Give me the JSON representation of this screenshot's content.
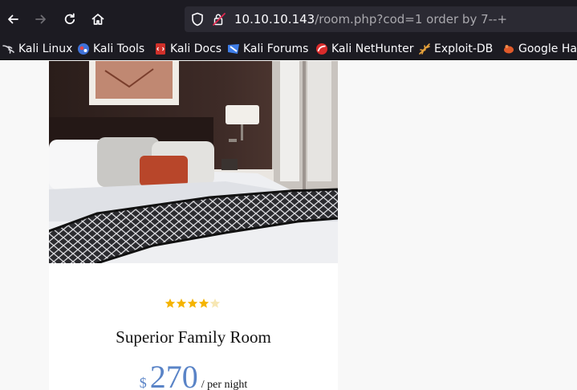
{
  "browser": {
    "url_host": "10.10.10.143",
    "url_path": "/room.php?cod=1 order by 7--+",
    "bookmarks": [
      {
        "label": "Kali Linux",
        "icon": "kali-dragon-icon"
      },
      {
        "label": "Kali Tools",
        "icon": "kali-tools-icon"
      },
      {
        "label": "Kali Docs",
        "icon": "kali-docs-icon"
      },
      {
        "label": "Kali Forums",
        "icon": "kali-forums-icon"
      },
      {
        "label": "Kali NetHunter",
        "icon": "kali-nethunter-icon"
      },
      {
        "label": "Exploit-DB",
        "icon": "exploit-db-icon"
      },
      {
        "label": "Google Hac",
        "icon": "google-hacking-icon"
      }
    ]
  },
  "room": {
    "name": "Superior Family Room",
    "currency": "$",
    "price": "270",
    "price_suffix": "/ per night",
    "rating_stars": 4,
    "rating_max": 5,
    "star_color": "#f5b400",
    "price_color": "#5a84c7"
  }
}
